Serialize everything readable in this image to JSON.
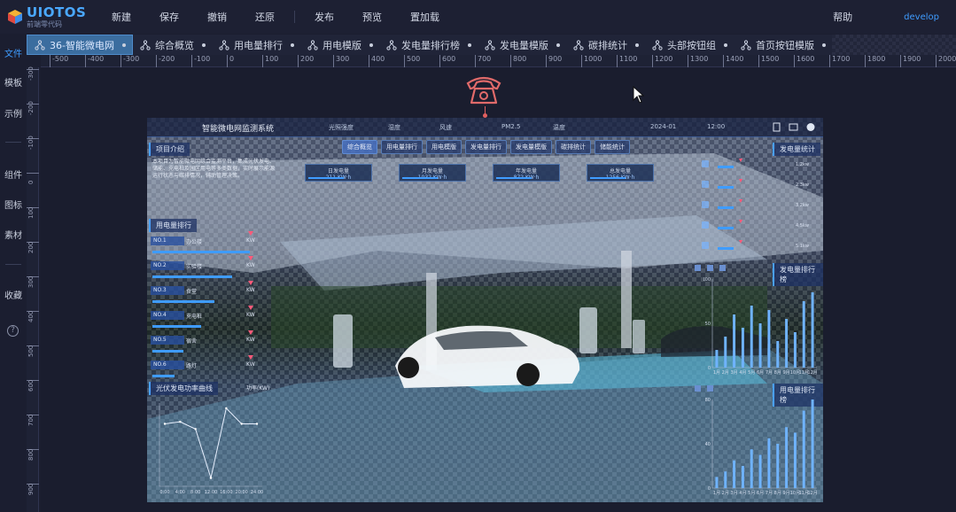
{
  "app": {
    "brand": "UIOTOS",
    "tagline": "前端零代码"
  },
  "topmenu": [
    "新建",
    "保存",
    "撤销",
    "还原",
    "发布",
    "预览",
    "置加载"
  ],
  "topright": {
    "help": "帮助",
    "user": "develop"
  },
  "sidebar": {
    "group1": [
      "文件",
      "模板",
      "示例"
    ],
    "group2": [
      "组件",
      "图标",
      "素材"
    ],
    "group3": [
      "收藏"
    ],
    "help": "?"
  },
  "tabs": [
    {
      "label": "36-智能微电网",
      "active": true
    },
    {
      "label": "综合概览"
    },
    {
      "label": "用电量排行"
    },
    {
      "label": "用电模版"
    },
    {
      "label": "发电量排行榜"
    },
    {
      "label": "发电量模版"
    },
    {
      "label": "碳排统计"
    },
    {
      "label": "头部按钮组"
    },
    {
      "label": "首页按钮模版"
    }
  ],
  "ruler": {
    "h": [
      "-500",
      "-400",
      "-300",
      "-200",
      "-100",
      "0",
      "100",
      "200",
      "300",
      "400",
      "500",
      "600",
      "700",
      "800",
      "900",
      "1000",
      "1100",
      "1200",
      "1300",
      "1400",
      "1500",
      "1600",
      "1700",
      "1800",
      "1900",
      "2000"
    ],
    "v": [
      "-300",
      "-200",
      "-100",
      "0",
      "100",
      "200",
      "300",
      "400",
      "500",
      "600",
      "700",
      "800",
      "900"
    ]
  },
  "dashboard": {
    "title": "智能微电网监测系统",
    "meta": [
      "光照强度",
      "湿度",
      "风速",
      "PM2.5",
      "温度",
      "2024-01",
      "12:00"
    ],
    "nav": [
      "综合概览",
      "用电量排行",
      "用电模版",
      "发电量排行",
      "发电量模版",
      "碳排统计",
      "储能统计"
    ],
    "intro_title": "项目介绍",
    "intro_text": "本项目为智能微电网综合监测平台，集成光伏发电、储能、充电桩及园区用电等多类数据，实时展示能源运行状态与碳排情况，辅助管理决策。",
    "kpis": [
      {
        "label": "日发电量",
        "value": "211 KW·h"
      },
      {
        "label": "月发电量",
        "value": "1032 KW·h"
      },
      {
        "label": "年发电量",
        "value": "872 KW·h"
      },
      {
        "label": "总发电量",
        "value": "1256 KW·h"
      }
    ],
    "rank_title": "用电量排行",
    "rank": [
      {
        "badge": "NO.1",
        "name": "办公楼",
        "value": "KW"
      },
      {
        "badge": "NO.2",
        "name": "实验楼",
        "value": "KW"
      },
      {
        "badge": "NO.3",
        "name": "食堂",
        "value": "KW"
      },
      {
        "badge": "NO.4",
        "name": "充电桩",
        "value": "KW"
      },
      {
        "badge": "NO.5",
        "name": "宿舍",
        "value": "KW"
      },
      {
        "badge": "NO.6",
        "name": "路灯",
        "value": "KW"
      }
    ],
    "curve_title": "光伏发电功率曲线",
    "curve_unit": "功率(KW)",
    "right_title1": "发电量统计",
    "right_title2": "发电量排行榜",
    "right_title3": "用电量排行榜",
    "side_values": [
      "1.2kw",
      "2.3kw",
      "3.2kw",
      "4.5kw",
      "5.1kw"
    ],
    "months": [
      "1月",
      "2月",
      "3月",
      "4月",
      "5月",
      "6月",
      "7月",
      "8月",
      "9月",
      "10月",
      "11月",
      "12月"
    ]
  },
  "chart_data": [
    {
      "type": "line",
      "x": [
        "0:00",
        "4:00",
        "8:00",
        "12:00",
        "16:00",
        "20:00",
        "24:00"
      ],
      "values": [
        60,
        62,
        55,
        8,
        75,
        60,
        60
      ],
      "ylim": [
        0,
        80
      ]
    },
    {
      "type": "bar",
      "categories": [
        "1月",
        "2月",
        "3月",
        "4月",
        "5月",
        "6月",
        "7月",
        "8月",
        "9月",
        "10月",
        "11月",
        "12月"
      ],
      "values": [
        20,
        35,
        60,
        45,
        70,
        50,
        65,
        30,
        55,
        40,
        75,
        85
      ],
      "ylim": [
        0,
        100
      ]
    },
    {
      "type": "bar",
      "categories": [
        "1月",
        "2月",
        "3月",
        "4月",
        "5月",
        "6月",
        "7月",
        "8月",
        "9月",
        "10月",
        "11月",
        "12月"
      ],
      "values": [
        10,
        15,
        25,
        20,
        35,
        30,
        45,
        40,
        55,
        50,
        70,
        80
      ],
      "ylim": [
        0,
        80
      ]
    }
  ]
}
